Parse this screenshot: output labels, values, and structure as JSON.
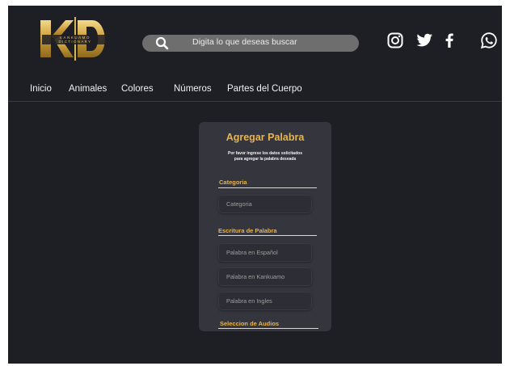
{
  "header": {
    "logo": {
      "letters": "KD",
      "subtitle_line1": "KANKUAMO",
      "subtitle_line2": "DICTIONARY"
    },
    "search": {
      "placeholder": "Digita lo que deseas buscar",
      "icon": "search-icon"
    },
    "social_icons": [
      "instagram-icon",
      "twitter-icon",
      "facebook-icon",
      "whatsapp-icon"
    ]
  },
  "nav": {
    "items": [
      {
        "label": "Inicio"
      },
      {
        "label": "Animales"
      },
      {
        "label": "Colores"
      },
      {
        "label": "Números"
      },
      {
        "label": "Partes del Cuerpo"
      }
    ]
  },
  "form": {
    "title": "Agregar Palabra",
    "description_line1": "Por favor ingrese los datos solicitados",
    "description_line2": "para agregar  la palabra deseada",
    "category_label": "Categoria",
    "category_placeholder": "Categoria",
    "writing_label": "Escritura de Palabra",
    "spanish_placeholder": "Palabra en Español",
    "kankuamo_placeholder": "Palabra en Kankuamo",
    "english_placeholder": "Palabra en Ingles",
    "audio_label": "Seleccion de Audios"
  },
  "colors": {
    "background": "#1e1f25",
    "card": "#34353d",
    "accent": "#e9b44c",
    "search_bar": "#6e6e6e"
  }
}
